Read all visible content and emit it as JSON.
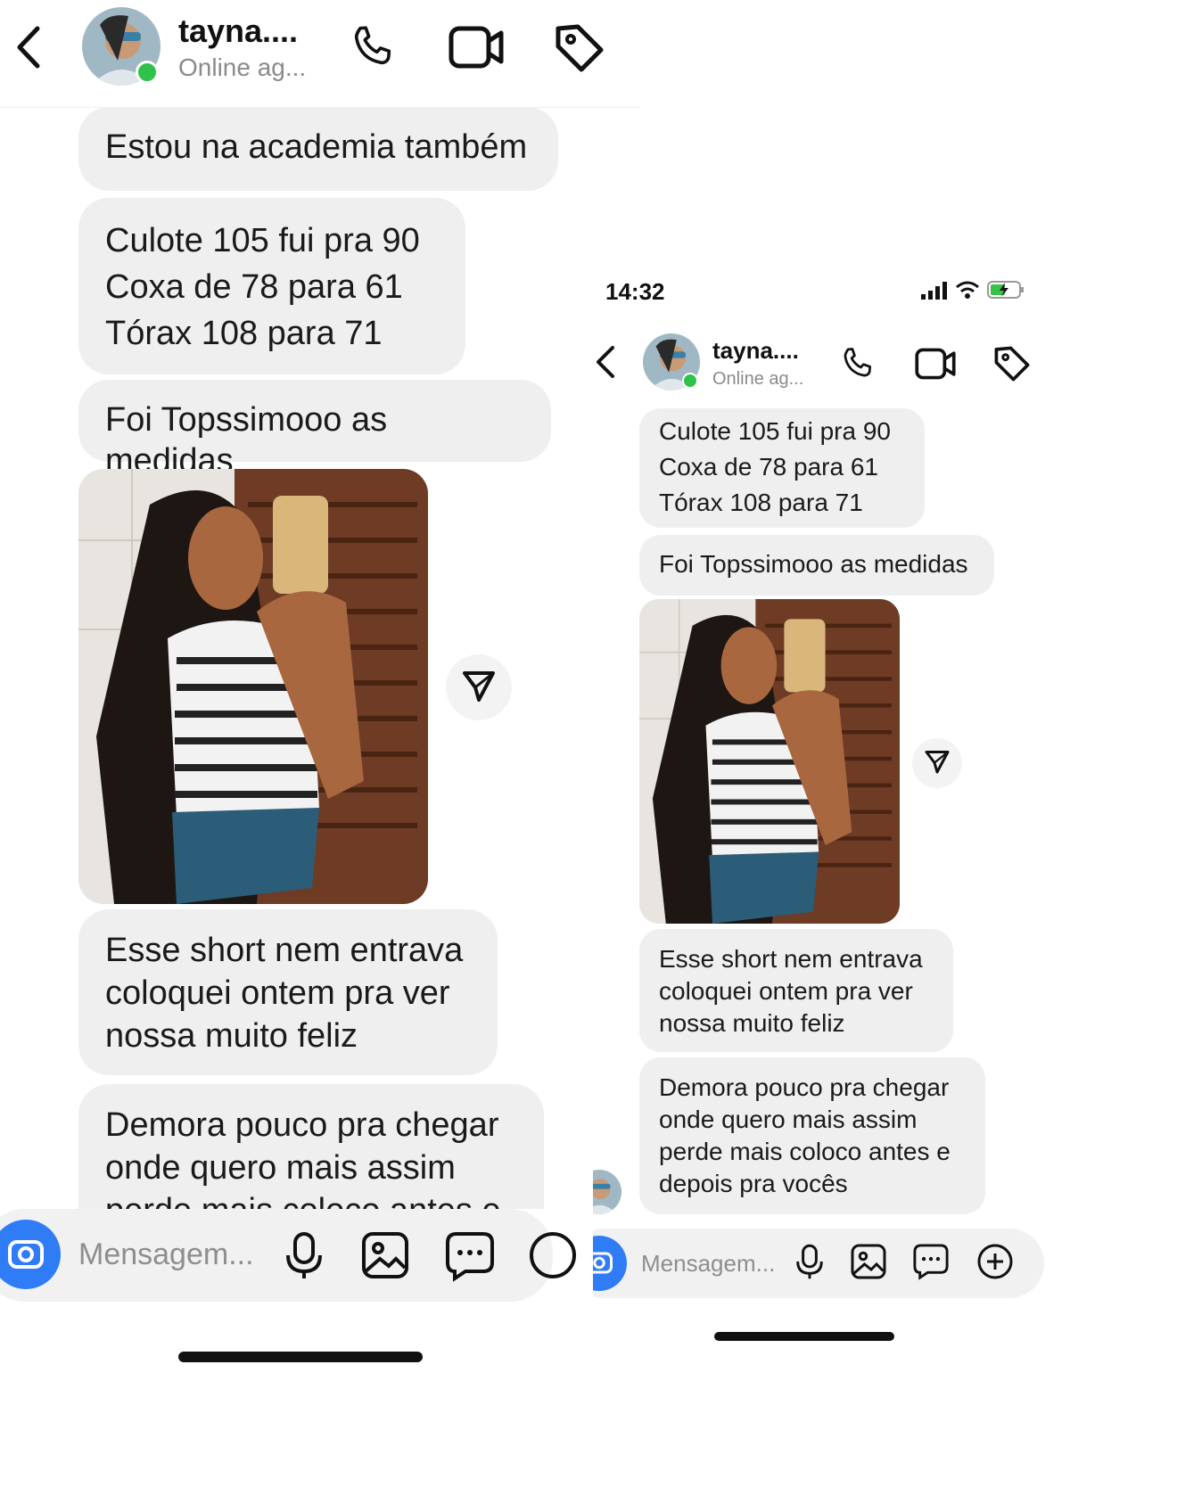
{
  "left": {
    "header": {
      "name": "tayna....",
      "status": "Online ag..."
    },
    "messages": [
      "Estou na academia também",
      "Culote 105 fui pra 90\nCoxa de 78 para 61\nTórax 108 para 71",
      "Foi Topssimooo as medidas",
      "Esse short nem entrava\ncoloquei ontem pra ver\nnossa muito feliz",
      "Demora pouco pra chegar\nonde quero mais assim\nperde mais coloco antes e"
    ],
    "composer": {
      "placeholder": "Mensagem..."
    }
  },
  "right": {
    "status_bar": {
      "time": "14:32"
    },
    "header": {
      "name": "tayna....",
      "status": "Online ag..."
    },
    "messages": [
      "Culote 105 fui pra 90\nCoxa de 78 para 61\nTórax 108 para 71",
      "Foi Topssimooo as medidas",
      "Esse short nem entrava\ncoloquei ontem pra ver\nnossa muito feliz",
      "Demora pouco pra chegar\nonde quero mais assim\nperde mais coloco antes e\ndepois pra vocês"
    ],
    "composer": {
      "placeholder": "Mensagem..."
    }
  },
  "icons": {
    "back": "chevron-left-icon",
    "call": "phone-icon",
    "video": "video-camera-icon",
    "tag": "tag-icon",
    "share": "paper-plane-icon",
    "camera": "camera-icon",
    "mic": "microphone-icon",
    "gallery": "image-icon",
    "sticker": "chat-bubble-icon",
    "plus": "plus-circle-icon"
  },
  "colors": {
    "bubble_bg": "#efefef",
    "accent_blue": "#2f7cf6",
    "online_green": "#2ec24a",
    "muted_text": "#8a8a8a"
  }
}
